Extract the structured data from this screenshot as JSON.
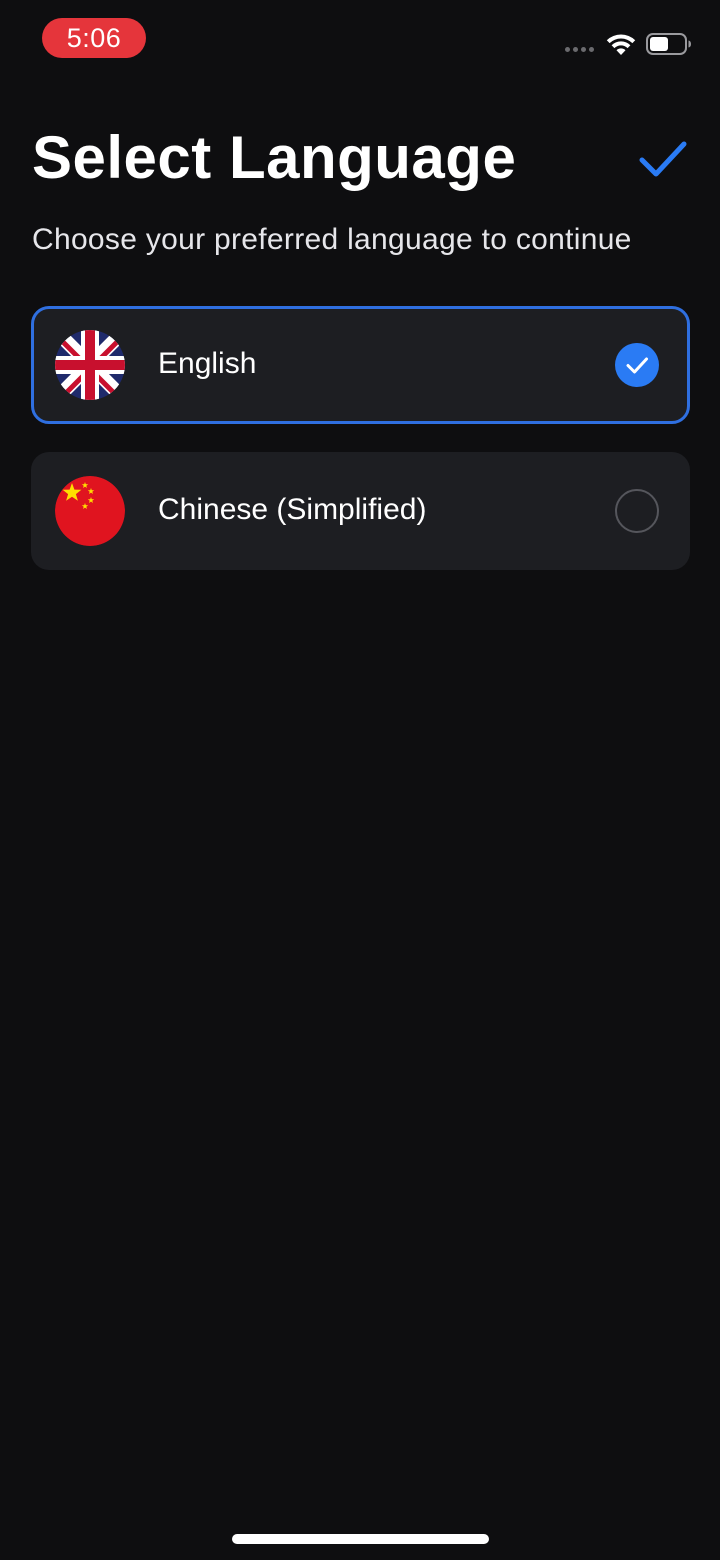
{
  "status_bar": {
    "time": "5:06",
    "time_pill_color": "#e5353b",
    "icons": [
      "signal-dots-icon",
      "wifi-icon",
      "battery-icon"
    ]
  },
  "header": {
    "title": "Select Language",
    "done_icon": "checkmark-icon",
    "accent_color": "#2a7bf4"
  },
  "subtitle": "Choose your preferred language to continue",
  "languages": [
    {
      "label": "English",
      "flag_icon": "uk-flag-icon",
      "selected": true
    },
    {
      "label": "Chinese (Simplified)",
      "flag_icon": "china-flag-icon",
      "selected": false
    }
  ]
}
